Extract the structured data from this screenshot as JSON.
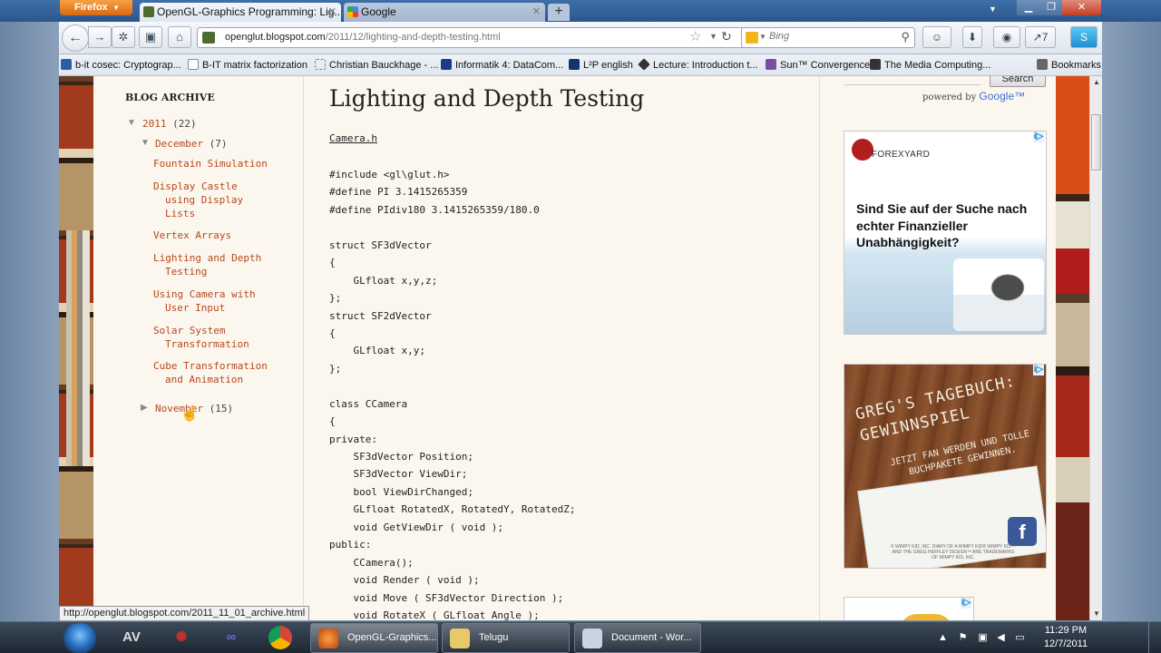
{
  "browser": {
    "menu_label": "Firefox",
    "tabs": [
      {
        "title": "OpenGL-Graphics Programming: Lig..."
      },
      {
        "title": "Google"
      }
    ],
    "new_tab": "+",
    "url_host": "openglut.blogspot.com",
    "url_path": "/2011/12/lighting-and-depth-testing.html",
    "search_placeholder": "Bing",
    "notification_count": "7",
    "bookmarks": [
      {
        "label": "b-it cosec: Cryptograp..."
      },
      {
        "label": "B-IT matrix factorization"
      },
      {
        "label": "Christian Bauckhage - ..."
      },
      {
        "label": "Informatik 4: DataCom..."
      },
      {
        "label": "L²P english"
      },
      {
        "label": "Lecture: Introduction t..."
      },
      {
        "label": "Sun™ Convergence"
      },
      {
        "label": "The Media Computing..."
      }
    ],
    "bookmarks_menu": "Bookmarks",
    "status_url": "http://openglut.blogspot.com/2011_11_01_archive.html"
  },
  "sidebar": {
    "title": "BLOG ARCHIVE",
    "year": {
      "label": "2011",
      "count": "(22)"
    },
    "month_open": {
      "label": "December",
      "count": "(7)"
    },
    "posts": [
      {
        "line1": "Fountain Simulation",
        "line2": ""
      },
      {
        "line1": "Display Castle",
        "line2": "using Display",
        "line3": "Lists"
      },
      {
        "line1": "Vertex Arrays",
        "line2": ""
      },
      {
        "line1": "Lighting and Depth",
        "line2": "Testing"
      },
      {
        "line1": "Using Camera with",
        "line2": "User Input"
      },
      {
        "line1": "Solar System",
        "line2": "Transformation"
      },
      {
        "line1": "Cube Transformation",
        "line2": "and Animation"
      }
    ],
    "month_closed": {
      "label": "November",
      "count": "(15)"
    }
  },
  "post": {
    "title": "Lighting and Depth Testing",
    "file_link": "Camera.h",
    "code_lines": [
      "#include <gl\\glut.h>",
      "#define PI 3.1415265359",
      "#define PIdiv180 3.1415265359/180.0",
      "",
      "struct SF3dVector",
      "{",
      "    GLfloat x,y,z;",
      "};",
      "struct SF2dVector",
      "{",
      "    GLfloat x,y;",
      "};",
      "",
      "class CCamera",
      "{",
      "private:",
      "    SF3dVector Position;",
      "    SF3dVector ViewDir;",
      "    bool ViewDirChanged;",
      "    GLfloat RotatedX, RotatedY, RotatedZ;",
      "    void GetViewDir ( void );",
      "public:",
      "    CCamera();",
      "    void Render ( void );",
      "    void Move ( SF3dVector Direction );",
      "    void RotateX ( GLfloat Angle );"
    ]
  },
  "right_sidebar": {
    "search_button": "Search",
    "powered_by": "powered by",
    "google": "Google™",
    "ad1": {
      "brand": "FOREXYARD",
      "text": "Sind Sie auf der Suche nach echter Finanzieller Unabhängigkeit?"
    },
    "ad2": {
      "title": "GREG'S TAGEBUCH: GEWINNSPIEL",
      "text": "JETZT FAN WERDEN UND TOLLE BUCHPAKETE GEWINNEN.",
      "small": "© WIMPY KID, INC. DIARY OF A WIMPY KID® WIMPY KID™ AND THE GREG HEFFLEY DESIGN™ ARE TRADEMARKS OF WIMPY KID, INC.",
      "fb": "f"
    },
    "ad_choices": "i▷"
  },
  "taskbar": {
    "tasks": [
      {
        "label": "OpenGL-Graphics..."
      },
      {
        "label": "Telugu"
      },
      {
        "label": "Document - Wor..."
      }
    ],
    "time": "11:29 PM",
    "date": "12/7/2011"
  },
  "colors": {
    "link": "#b6471e",
    "page_bg": "#fbf7ee"
  }
}
